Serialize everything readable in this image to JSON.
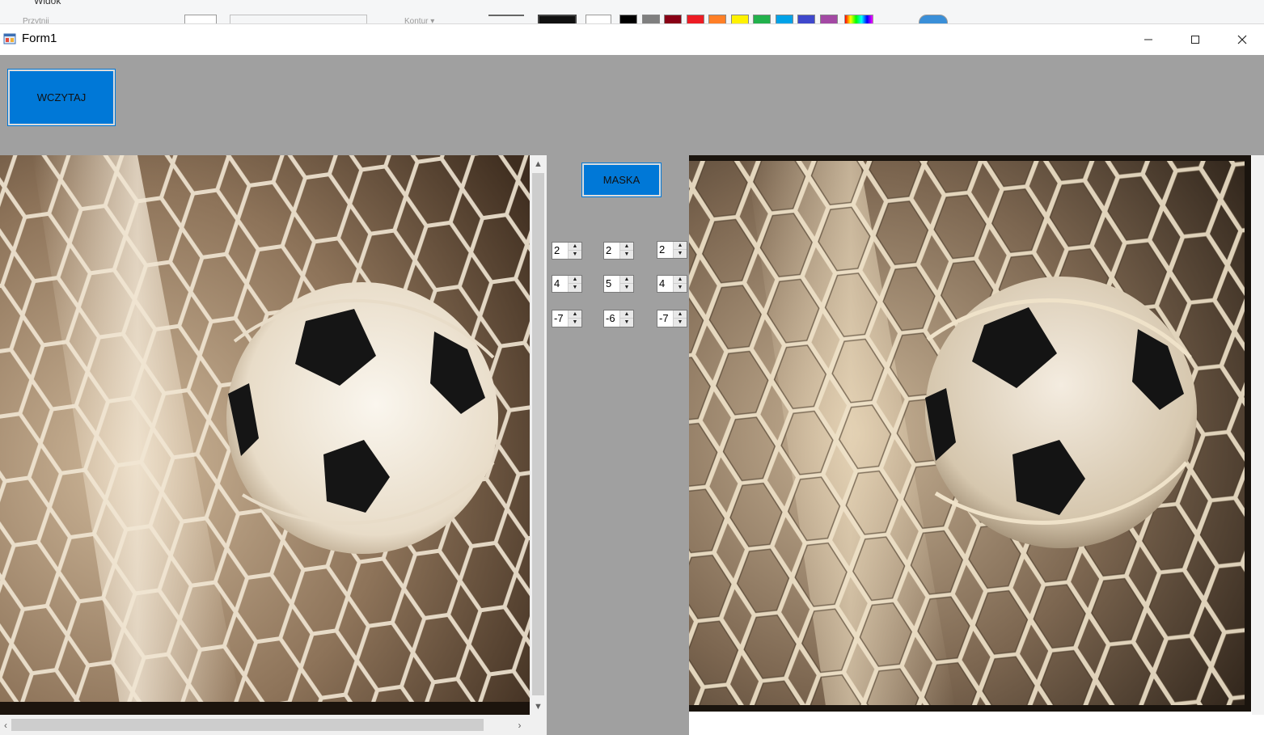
{
  "window": {
    "title": "Form1"
  },
  "background_app": {
    "tab_label": "Widok",
    "faded_label_1": "Przytnij",
    "faded_label_2": "Kontur ▾"
  },
  "controls": {
    "load_button_label": "WCZYTAJ",
    "mask_button_label": "MASKA"
  },
  "mask": {
    "rows": [
      [
        "2",
        "2",
        "2"
      ],
      [
        "4",
        "5",
        "4"
      ],
      [
        "-7",
        "-6",
        "-7"
      ]
    ]
  },
  "colors": {
    "accent": "#0078d7",
    "client_bg": "#a0a0a0",
    "palette": [
      "#000000",
      "#7f7f7f",
      "#880015",
      "#ed1c24",
      "#ff7f27",
      "#fff200",
      "#22b14c",
      "#00a2e8",
      "#3f48cc",
      "#a349a4"
    ]
  },
  "icons": {
    "app": "form-app-icon",
    "minimize": "minimize-icon",
    "maximize": "maximize-icon",
    "close": "close-icon"
  },
  "images": {
    "left": "source-photo-soccer-ball-in-net",
    "right": "embossed-result-soccer-ball-in-net"
  }
}
